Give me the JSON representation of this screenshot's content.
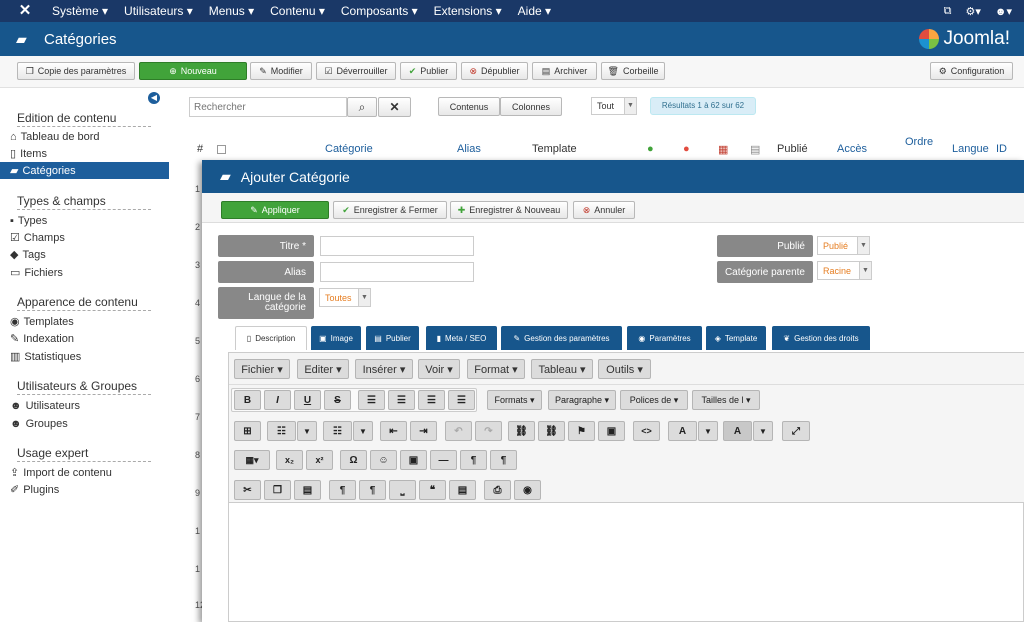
{
  "topnav": {
    "menu": [
      "Système ▾",
      "Utilisateurs ▾",
      "Menus ▾",
      "Contenu ▾",
      "Composants ▾",
      "Extensions ▾",
      "Aide ▾"
    ],
    "right_icons": [
      "external-link-icon",
      "gear-icon",
      "user-icon"
    ]
  },
  "titlebar": {
    "title": "Catégories",
    "brand": "Joomla!"
  },
  "toolbar": {
    "copy": "Copie des paramètres",
    "new": "Nouveau",
    "edit": "Modifier",
    "unlock": "Déverrouiller",
    "publish": "Publier",
    "unpublish": "Dépublier",
    "archive": "Archiver",
    "trash": "Corbeille",
    "config": "Configuration"
  },
  "sidebar": {
    "s1": "Edition de contenu",
    "i1": "Tableau de bord",
    "i2": "Items",
    "i3": "Catégories",
    "s2": "Types & champs",
    "i4": "Types",
    "i5": "Champs",
    "i6": "Tags",
    "i7": "Fichiers",
    "s3": "Apparence de contenu",
    "i8": "Templates",
    "i9": "Indexation",
    "i10": "Statistiques",
    "s4": "Utilisateurs & Groupes",
    "i11": "Utilisateurs",
    "i12": "Groupes",
    "s5": "Usage expert",
    "i13": "Import de contenu",
    "i14": "Plugins"
  },
  "list": {
    "search_placeholder": "Rechercher",
    "contents_btn": "Contenus",
    "columns_btn": "Colonnes",
    "filter": "Tout",
    "results": "Résultats 1 à 62 sur 62",
    "headers": {
      "num": "#",
      "category": "Catégorie",
      "alias": "Alias",
      "template": "Template",
      "published": "Publié",
      "access": "Accès",
      "order": "Ordre",
      "language": "Langue",
      "id": "ID"
    },
    "row_numbers": [
      "1",
      "2",
      "3",
      "4",
      "5",
      "6",
      "7",
      "8",
      "9",
      "1",
      "1",
      "12"
    ]
  },
  "modal": {
    "title": "Ajouter Catégorie",
    "apply": "Appliquer",
    "save_close": "Enregistrer & Fermer",
    "save_new": "Enregistrer & Nouveau",
    "cancel": "Annuler",
    "title_label": "Titre *",
    "alias_label": "Alias",
    "lang_label": "Langue de la catégorie",
    "lang_value": "Toutes",
    "published_label": "Publié",
    "published_value": "Publié",
    "parent_label": "Catégorie parente",
    "parent_value": "Racine",
    "tabs": [
      "Description",
      "Image",
      "Publier",
      "Meta / SEO",
      "Gestion des paramètres",
      "Paramètres",
      "Template",
      "Gestion des droits"
    ],
    "editor_menu": [
      "Fichier ▾",
      "Editer ▾",
      "Insérer ▾",
      "Voir ▾",
      "Format ▾",
      "Tableau ▾",
      "Outils ▾"
    ],
    "formats": [
      "Formats ▾",
      "Paragraphe ▾",
      "Polices de ▾",
      "Tailles de l ▾"
    ]
  }
}
